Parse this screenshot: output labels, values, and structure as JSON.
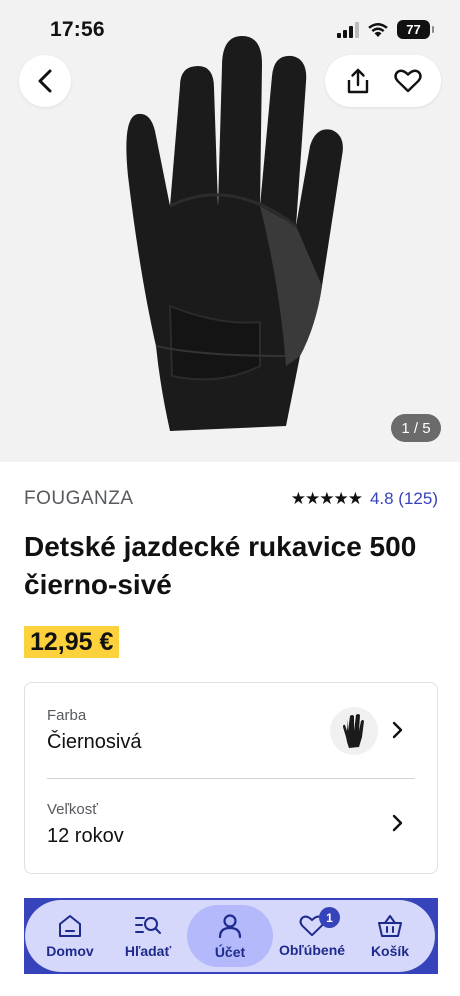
{
  "status_bar": {
    "time": "17:56",
    "battery": "77"
  },
  "gallery": {
    "pager": "1 / 5",
    "back_icon": "chevron-left-icon",
    "share_icon": "share-icon",
    "favorite_icon": "heart-icon"
  },
  "product": {
    "brand": "FOUGANZA",
    "stars": "★★★★★",
    "rating": "4.8 (125)",
    "title": "Detské jazdecké rukavice 500 čierno-sivé",
    "price": "12,95 €"
  },
  "options": {
    "color_label": "Farba",
    "color_value": "Čiernosivá",
    "size_label": "Veľkosť",
    "size_value": "12 rokov"
  },
  "nav": {
    "items": [
      {
        "label": "Domov",
        "icon": "home-icon"
      },
      {
        "label": "Hľadať",
        "icon": "search-list-icon"
      },
      {
        "label": "Účet",
        "icon": "account-icon"
      },
      {
        "label": "Obľúbené",
        "icon": "heart-icon",
        "badge": "1"
      },
      {
        "label": "Košík",
        "icon": "basket-icon"
      }
    ]
  },
  "colors": {
    "accent": "#3643ba",
    "price_highlight": "#fcd13b",
    "nav_background": "#d5d8fb",
    "nav_active": "#b3b9fb"
  }
}
